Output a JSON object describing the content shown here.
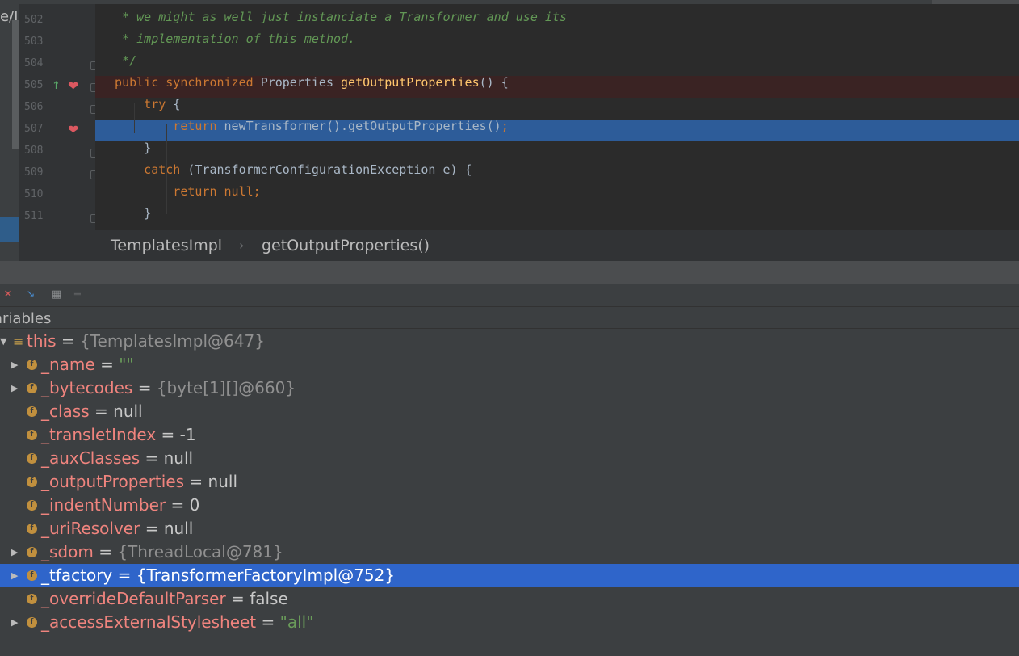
{
  "project_panel": {
    "partial_text": "e/I"
  },
  "editor": {
    "lines": [
      {
        "num": "502",
        "segments": [
          {
            "cls": "comment",
            "text": "   * we might as well just instanciate a Transformer and use its"
          }
        ]
      },
      {
        "num": "503",
        "segments": [
          {
            "cls": "comment",
            "text": "   * implementation of this method."
          }
        ]
      },
      {
        "num": "504",
        "segments": [
          {
            "cls": "comment",
            "text": "   */"
          }
        ]
      },
      {
        "num": "505",
        "segments": [
          {
            "cls": "kw",
            "text": "  public synchronized "
          },
          {
            "cls": "plain",
            "text": "Properties "
          },
          {
            "cls": "method",
            "text": "getOutputProperties"
          },
          {
            "cls": "plain",
            "text": "() {"
          }
        ]
      },
      {
        "num": "506",
        "segments": [
          {
            "cls": "kw",
            "text": "      try "
          },
          {
            "cls": "plain",
            "text": "{"
          }
        ]
      },
      {
        "num": "507",
        "segments": [
          {
            "cls": "kw",
            "text": "          return "
          },
          {
            "cls": "plain",
            "text": "newTransformer().getOutputProperties()"
          },
          {
            "cls": "kw",
            "text": ";"
          }
        ]
      },
      {
        "num": "508",
        "segments": [
          {
            "cls": "plain",
            "text": "      }"
          }
        ]
      },
      {
        "num": "509",
        "segments": [
          {
            "cls": "kw",
            "text": "      catch "
          },
          {
            "cls": "plain",
            "text": "(TransformerConfigurationException e) {"
          }
        ]
      },
      {
        "num": "510",
        "segments": [
          {
            "cls": "kw",
            "text": "          return null;"
          }
        ]
      },
      {
        "num": "511",
        "segments": [
          {
            "cls": "plain",
            "text": "      }"
          }
        ]
      }
    ]
  },
  "breadcrumbs": {
    "class_name": "TemplatesImpl",
    "separator": "›",
    "method_name": "getOutputProperties()"
  },
  "debugger": {
    "toolbar_icons": [
      "remove-watch-icon",
      "step-into-icon",
      "table-view-icon",
      "settings-icon"
    ],
    "variables_title": "ariables",
    "root": {
      "name": "this",
      "eq": " = ",
      "value": "{TemplatesImpl@647}"
    },
    "fields": [
      {
        "name": "_name",
        "value": "\"\"",
        "kind": "str",
        "expandable": true
      },
      {
        "name": "_bytecodes",
        "value": "{byte[1][]@660}",
        "kind": "obj",
        "expandable": true
      },
      {
        "name": "_class",
        "value": "null",
        "kind": "val",
        "expandable": false
      },
      {
        "name": "_transletIndex",
        "value": "-1",
        "kind": "val",
        "expandable": false
      },
      {
        "name": "_auxClasses",
        "value": "null",
        "kind": "val",
        "expandable": false
      },
      {
        "name": "_outputProperties",
        "value": "null",
        "kind": "val",
        "expandable": false
      },
      {
        "name": "_indentNumber",
        "value": "0",
        "kind": "val",
        "expandable": false
      },
      {
        "name": "_uriResolver",
        "value": "null",
        "kind": "val",
        "expandable": false
      },
      {
        "name": "_sdom",
        "value": "{ThreadLocal@781}",
        "kind": "obj",
        "expandable": true
      },
      {
        "name": "_tfactory",
        "value": "{TransformerFactoryImpl@752}",
        "kind": "obj",
        "expandable": true,
        "selected": true
      },
      {
        "name": "_overrideDefaultParser",
        "value": "false",
        "kind": "val",
        "expandable": false
      },
      {
        "name": "_accessExternalStylesheet",
        "value": "\"all\"",
        "kind": "str",
        "expandable": true
      }
    ]
  },
  "colors": {
    "editor_bg": "#2b2b2b",
    "selection": "#2f65ca",
    "breakpoint_line": "#3a2323",
    "execution_line": "#2d5c99"
  }
}
